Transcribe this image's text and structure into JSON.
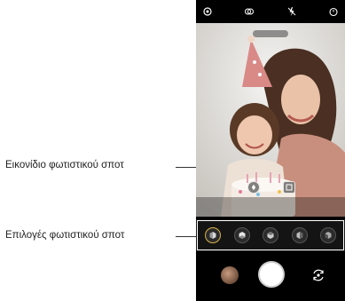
{
  "callouts": {
    "spotlight_icon": "Εικονίδιο φωτιστικού σποτ",
    "spotlight_options": "Επιλογές φωτιστικού σποτ"
  },
  "top_bar": {
    "icons": [
      "settings-icon",
      "effects-icon",
      "flash-off-icon",
      "timer-icon"
    ]
  },
  "viewfinder": {
    "controls": [
      "spotlight-icon",
      "focus-frame-icon"
    ]
  },
  "effects_bar": {
    "options": [
      "spotlight-option-1",
      "spotlight-option-2",
      "spotlight-option-3",
      "spotlight-option-4",
      "spotlight-option-5"
    ],
    "selected_index": 0,
    "accent_color": "#d7b347"
  },
  "bottom_bar": {
    "icons": [
      "gallery-thumbnail",
      "shutter-button",
      "switch-camera-icon"
    ]
  }
}
